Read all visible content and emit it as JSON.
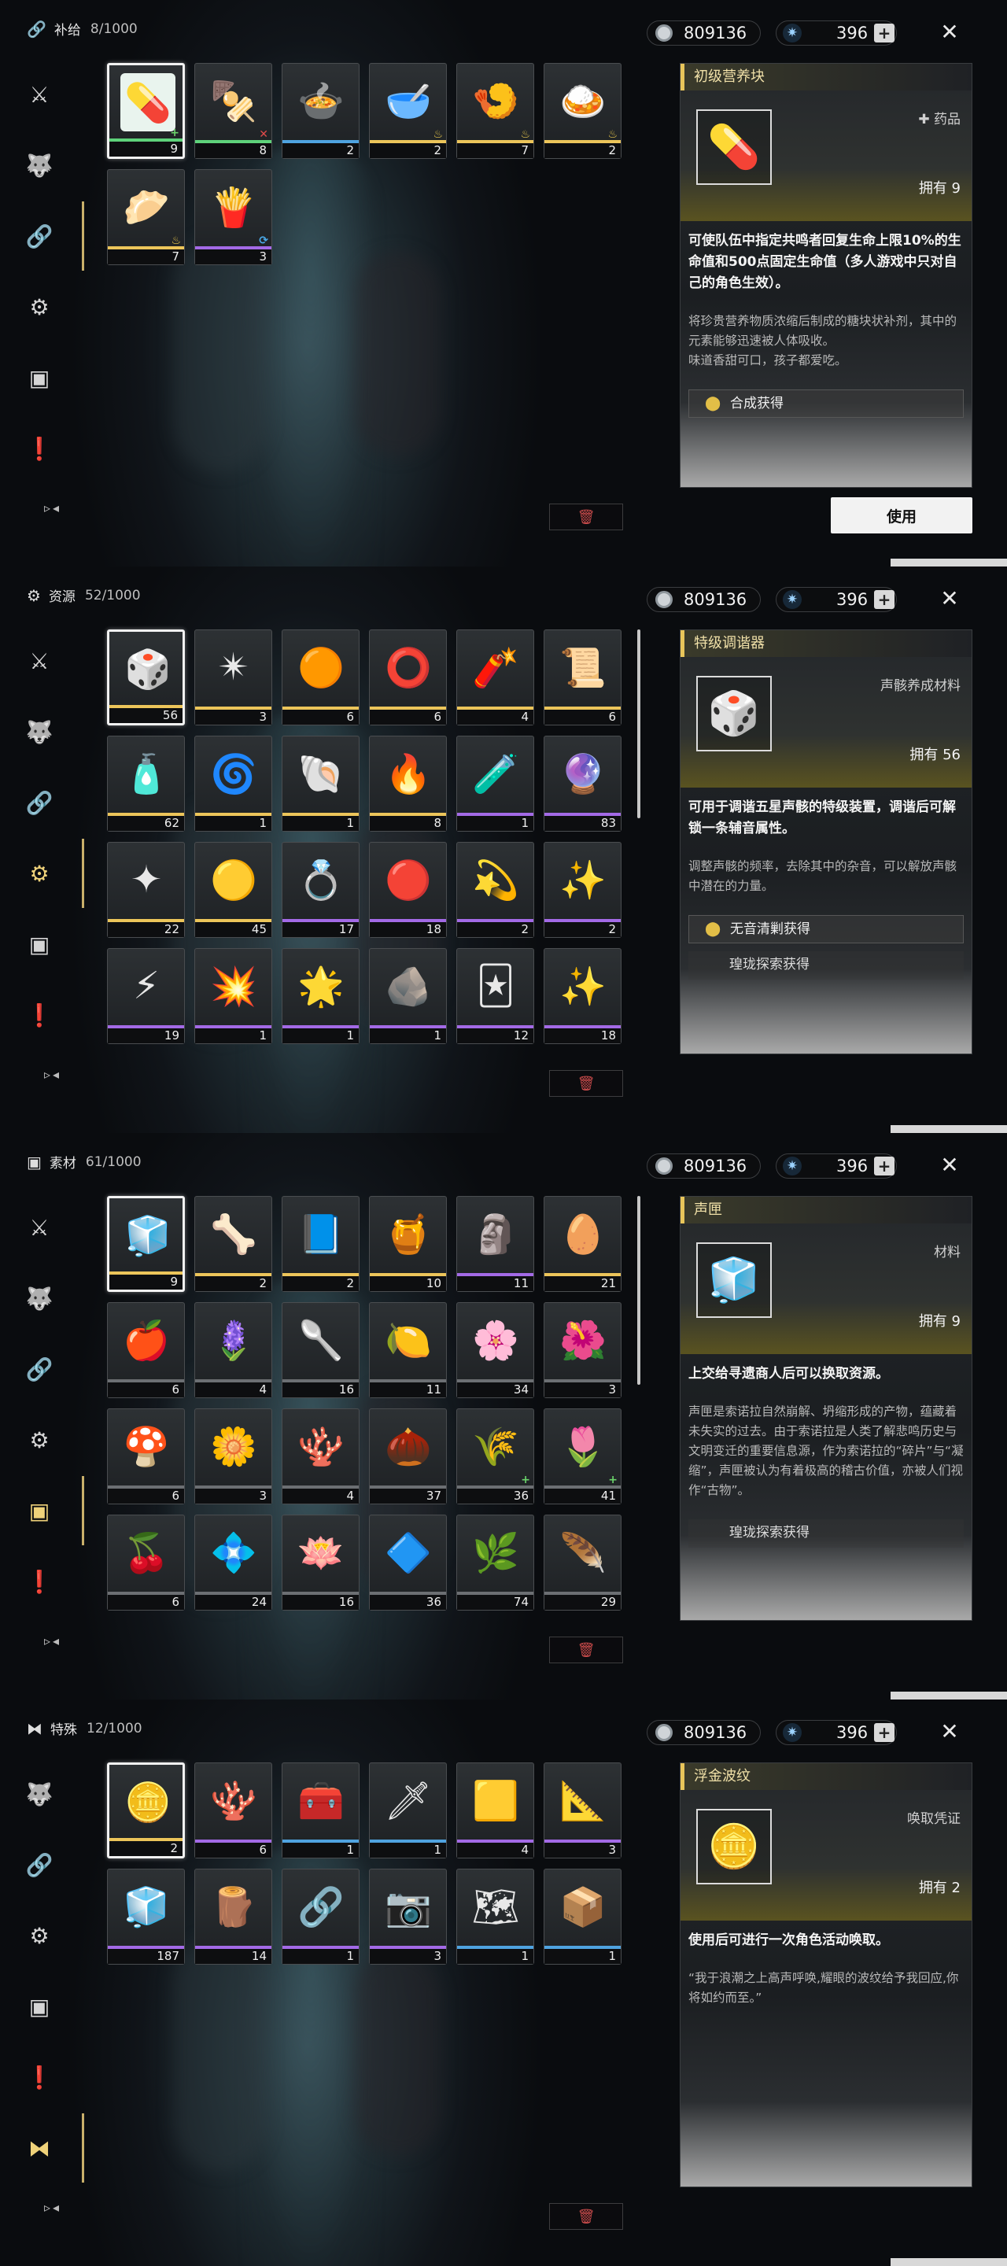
{
  "currency": {
    "shell_credit": "809136",
    "astrite": "396",
    "plus": "+"
  },
  "close_icon": "close-icon",
  "panels": [
    {
      "category": {
        "name": "补给",
        "count": "8/1000",
        "icon": "supply-icon"
      },
      "sidebar": [
        {
          "icon": "crossed-swords-icon"
        },
        {
          "icon": "wolf-head-icon"
        },
        {
          "icon": "chain-link-icon",
          "active": true
        },
        {
          "icon": "gear-gem-icon"
        },
        {
          "icon": "crate-icon"
        },
        {
          "icon": "exclamation-icon"
        }
      ],
      "items": [
        {
          "glyph": "💊",
          "bg": "#e9f4ee",
          "rarity": "r2",
          "qty": "9",
          "mark": "+",
          "mkc": "g",
          "sel": true
        },
        {
          "glyph": "🍢",
          "rarity": "r2",
          "qty": "8",
          "mark": "✕",
          "mkc": "r"
        },
        {
          "glyph": "🍲",
          "rarity": "r3",
          "qty": "2"
        },
        {
          "glyph": "🥣",
          "rarity": "r5",
          "qty": "2",
          "mark": "♨",
          "mkc": "y"
        },
        {
          "glyph": "🍤",
          "rarity": "r5",
          "qty": "7",
          "mark": "♨",
          "mkc": "y"
        },
        {
          "glyph": "🍛",
          "rarity": "r5",
          "qty": "2",
          "mark": "♨",
          "mkc": "y"
        },
        {
          "glyph": "🥟",
          "rarity": "r5",
          "qty": "7",
          "mark": "♨",
          "mkc": "y"
        },
        {
          "glyph": "🍟",
          "rarity": "r4",
          "qty": "3",
          "mark": "⟳",
          "mkc": "b"
        }
      ],
      "detail": {
        "title": "初级营养块",
        "glyph": "💊",
        "type": "✚ 药品",
        "owned": "拥有 9",
        "desc": "可使队伍中指定共鸣者回复生命上限10%的生命值和500点固定生命值（多人游戏中只对自己的角色生效）。",
        "flavor": "将珍贵营养物质浓缩后制成的糖块状补剂，其中的元素能够迅速被人体吸收。\n味道香甜可口，孩子都爱吃。",
        "sources": [
          {
            "label": "合成获得",
            "pin": true
          }
        ]
      },
      "use_button": "使用"
    },
    {
      "category": {
        "name": "资源",
        "count": "52/1000",
        "icon": "resource-icon"
      },
      "sidebar": [
        {
          "icon": "crossed-swords-icon"
        },
        {
          "icon": "wolf-head-icon"
        },
        {
          "icon": "chain-link-icon"
        },
        {
          "icon": "gear-gem-icon",
          "active": true
        },
        {
          "icon": "crate-icon"
        },
        {
          "icon": "exclamation-icon"
        }
      ],
      "items": [
        {
          "glyph": "🎲",
          "rarity": "r5",
          "qty": "56",
          "sel": true
        },
        {
          "glyph": "✴",
          "rarity": "r5",
          "qty": "3"
        },
        {
          "glyph": "🟠",
          "rarity": "r5",
          "qty": "6"
        },
        {
          "glyph": "⭕",
          "rarity": "r5",
          "qty": "6"
        },
        {
          "glyph": "🧨",
          "rarity": "r5",
          "qty": "4"
        },
        {
          "glyph": "📜",
          "rarity": "r5",
          "qty": "6"
        },
        {
          "glyph": "🧴",
          "rarity": "r5",
          "qty": "62"
        },
        {
          "glyph": "🌀",
          "rarity": "r5",
          "qty": "1"
        },
        {
          "glyph": "🐚",
          "rarity": "r5",
          "qty": "1"
        },
        {
          "glyph": "🔥",
          "rarity": "r5",
          "qty": "8"
        },
        {
          "glyph": "🧪",
          "rarity": "r4",
          "qty": "1"
        },
        {
          "glyph": "🔮",
          "rarity": "r4",
          "qty": "83"
        },
        {
          "glyph": "✦",
          "rarity": "r5",
          "qty": "22"
        },
        {
          "glyph": "🟡",
          "rarity": "r5",
          "qty": "45"
        },
        {
          "glyph": "💍",
          "rarity": "r4",
          "qty": "17"
        },
        {
          "glyph": "🔴",
          "rarity": "r4",
          "qty": "18"
        },
        {
          "glyph": "💫",
          "rarity": "r4",
          "qty": "2"
        },
        {
          "glyph": "✨",
          "rarity": "r4",
          "qty": "2"
        },
        {
          "glyph": "⚡",
          "rarity": "r4",
          "qty": "19"
        },
        {
          "glyph": "💥",
          "rarity": "r4",
          "qty": "1"
        },
        {
          "glyph": "🌟",
          "rarity": "r4",
          "qty": "1"
        },
        {
          "glyph": "🪨",
          "rarity": "r4",
          "qty": "1"
        },
        {
          "glyph": "🃏",
          "rarity": "r4",
          "qty": "12"
        },
        {
          "glyph": "✨",
          "rarity": "r4",
          "qty": "18"
        }
      ],
      "detail": {
        "title": "特级调谐器",
        "glyph": "🎲",
        "type": "声骸养成材料",
        "owned": "拥有 56",
        "desc": "可用于调谐五星声骸的特级装置，调谐后可解锁一条辅音属性。",
        "flavor": "调整声骸的频率，去除其中的杂音，可以解放声骸中潜在的力量。",
        "sources": [
          {
            "label": "无音清剿获得",
            "pin": true
          },
          {
            "label": "瑝珑探索获得",
            "pin": false
          }
        ]
      }
    },
    {
      "category": {
        "name": "素材",
        "count": "61/1000",
        "icon": "material-icon"
      },
      "sidebar": [
        {
          "icon": "crossed-swords-icon"
        },
        {
          "icon": "wolf-head-icon"
        },
        {
          "icon": "chain-link-icon"
        },
        {
          "icon": "gear-gem-icon"
        },
        {
          "icon": "crate-icon",
          "active": true
        },
        {
          "icon": "exclamation-icon"
        }
      ],
      "items": [
        {
          "glyph": "🧊",
          "rarity": "r5",
          "qty": "9",
          "sel": true
        },
        {
          "glyph": "🦴",
          "rarity": "r5",
          "qty": "2"
        },
        {
          "glyph": "📘",
          "rarity": "r5",
          "qty": "2"
        },
        {
          "glyph": "🍯",
          "rarity": "r5",
          "qty": "10"
        },
        {
          "glyph": "🗿",
          "rarity": "r4",
          "qty": "11"
        },
        {
          "glyph": "🥚",
          "rarity": "r5",
          "qty": "21"
        },
        {
          "glyph": "🍎",
          "rarity": "",
          "qty": "6"
        },
        {
          "glyph": "🪻",
          "rarity": "",
          "qty": "4"
        },
        {
          "glyph": "🥄",
          "rarity": "",
          "qty": "16"
        },
        {
          "glyph": "🍋",
          "rarity": "",
          "qty": "11"
        },
        {
          "glyph": "🌸",
          "rarity": "",
          "qty": "34"
        },
        {
          "glyph": "🌺",
          "rarity": "",
          "qty": "3"
        },
        {
          "glyph": "🍄",
          "rarity": "",
          "qty": "6"
        },
        {
          "glyph": "🌼",
          "rarity": "",
          "qty": "3"
        },
        {
          "glyph": "🪸",
          "rarity": "",
          "qty": "4"
        },
        {
          "glyph": "🌰",
          "rarity": "",
          "qty": "37"
        },
        {
          "glyph": "🌾",
          "rarity": "",
          "qty": "36",
          "mark": "+",
          "mkc": "g"
        },
        {
          "glyph": "🌷",
          "rarity": "",
          "qty": "41",
          "mark": "+",
          "mkc": "g"
        },
        {
          "glyph": "🍒",
          "rarity": "",
          "qty": "6"
        },
        {
          "glyph": "💠",
          "rarity": "",
          "qty": "24"
        },
        {
          "glyph": "🪷",
          "rarity": "",
          "qty": "16"
        },
        {
          "glyph": "🔷",
          "rarity": "",
          "qty": "36"
        },
        {
          "glyph": "🌿",
          "rarity": "",
          "qty": "74"
        },
        {
          "glyph": "🪶",
          "rarity": "",
          "qty": "29"
        }
      ],
      "detail": {
        "title": "声匣",
        "glyph": "🧊",
        "type": "材料",
        "owned": "拥有 9",
        "desc": "上交给寻遗商人后可以换取资源。",
        "flavor": "声匣是索诺拉自然崩解、坍缩形成的产物，蕴藏着未失实的过去。由于索诺拉是人类了解悲鸣历史与文明变迁的重要信息源，作为索诺拉的“碎片”与“凝缩”，声匣被认为有着极高的稽古价值，亦被人们视作“古物”。",
        "sources": [
          {
            "label": "瑝珑探索获得",
            "pin": false
          }
        ]
      }
    },
    {
      "category": {
        "name": "特殊",
        "count": "12/1000",
        "icon": "special-icon"
      },
      "sidebar": [
        {
          "icon": "wolf-head-icon"
        },
        {
          "icon": "chain-link-icon"
        },
        {
          "icon": "gear-gem-icon"
        },
        {
          "icon": "crate-icon"
        },
        {
          "icon": "exclamation-icon"
        },
        {
          "icon": "special-icon",
          "active": true
        }
      ],
      "items": [
        {
          "glyph": "🪙",
          "rarity": "r5",
          "qty": "2",
          "sel": true
        },
        {
          "glyph": "🪸",
          "rarity": "r4",
          "qty": "6"
        },
        {
          "glyph": "🧰",
          "rarity": "r3",
          "qty": "1"
        },
        {
          "glyph": "🗡",
          "rarity": "r3",
          "qty": "1"
        },
        {
          "glyph": "🟨",
          "rarity": "r4",
          "qty": "4"
        },
        {
          "glyph": "📐",
          "rarity": "r4",
          "qty": "3"
        },
        {
          "glyph": "🧊",
          "rarity": "r4",
          "qty": "187"
        },
        {
          "glyph": "🪵",
          "rarity": "r4",
          "qty": "14"
        },
        {
          "glyph": "🔗",
          "rarity": "r4",
          "qty": "1"
        },
        {
          "glyph": "📷",
          "rarity": "r4",
          "qty": "3"
        },
        {
          "glyph": "🗺",
          "rarity": "r3",
          "qty": "1"
        },
        {
          "glyph": "📦",
          "rarity": "r3",
          "qty": "1"
        }
      ],
      "detail": {
        "title": "浮金波纹",
        "glyph": "🪙",
        "type": "唤取凭证",
        "owned": "拥有 2",
        "desc": "使用后可进行一次角色活动唤取。",
        "flavor": "“我于浪潮之上高声呼唤,耀眼的波纹给予我回应,你将如约而至。”",
        "sources": []
      }
    }
  ]
}
